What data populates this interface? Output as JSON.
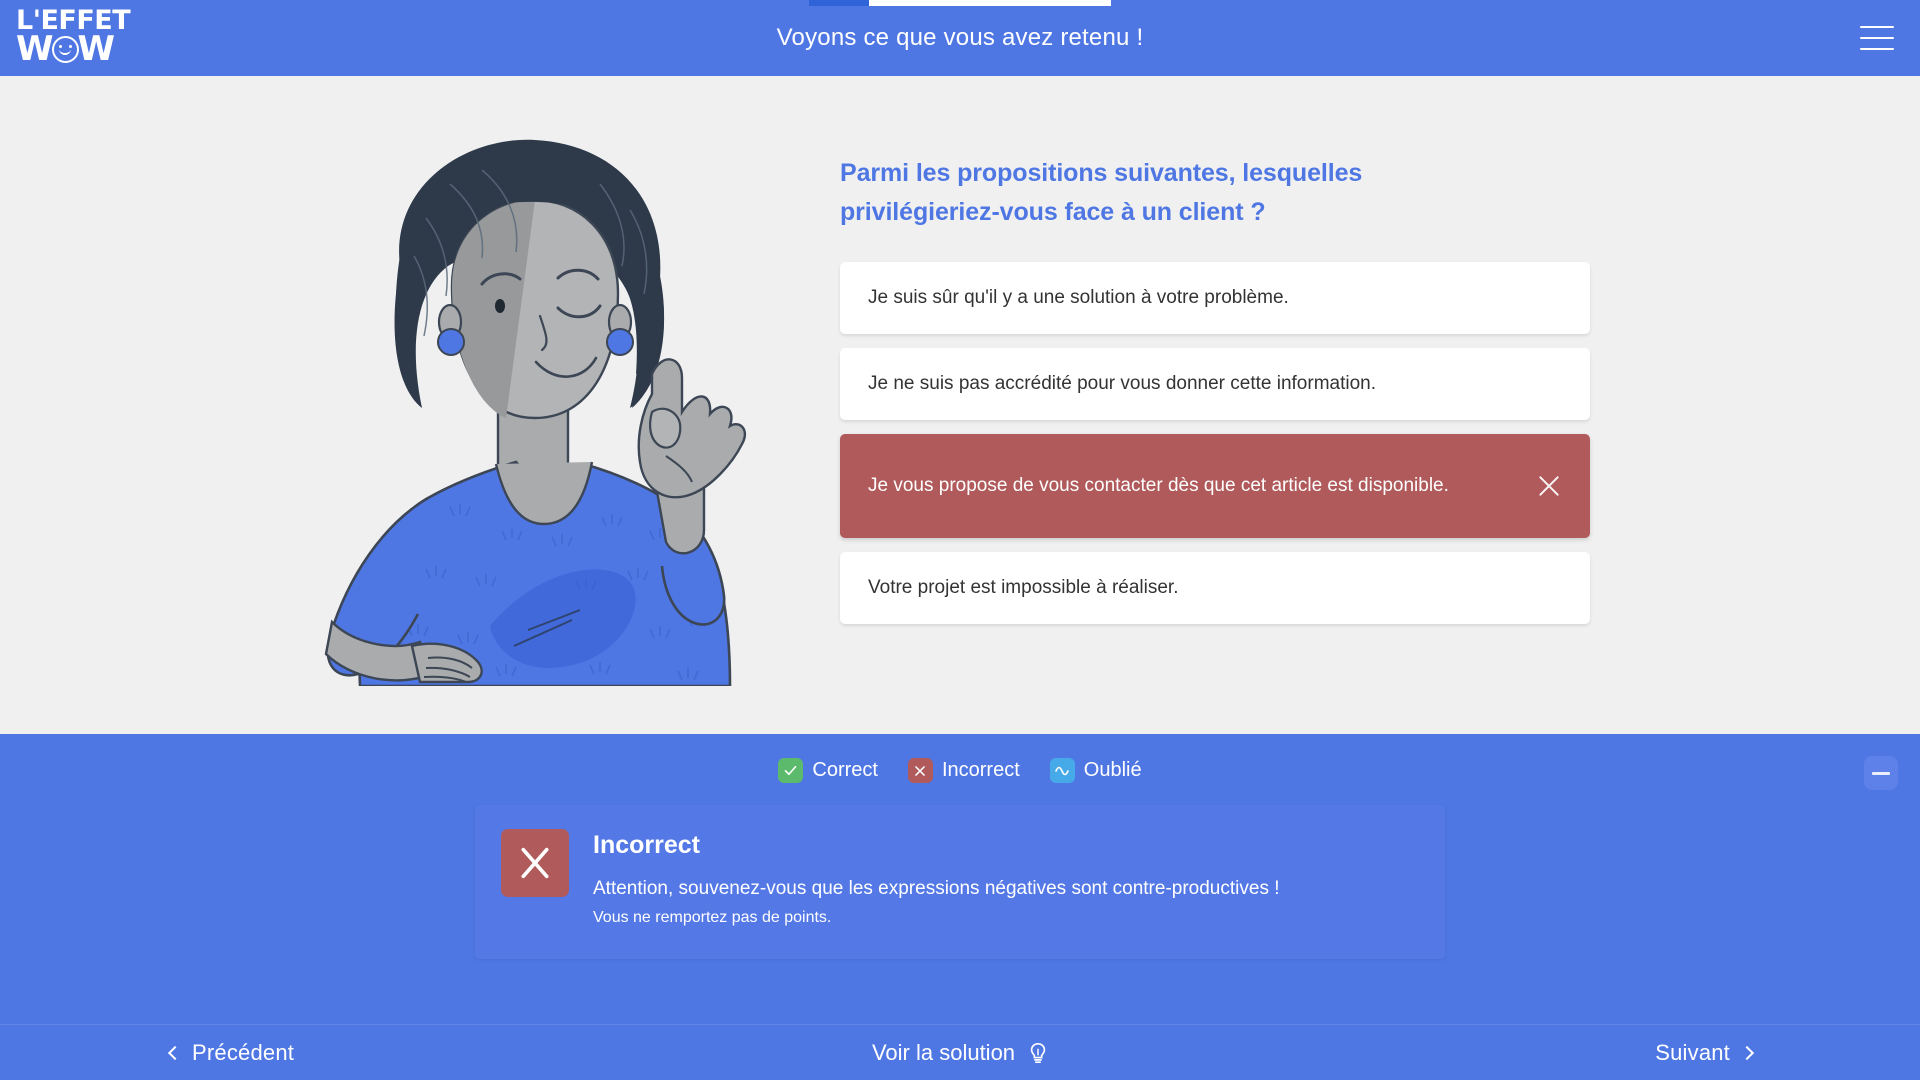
{
  "brand": {
    "logo_line1": "L'EFFET",
    "logo_line2_left": "W",
    "logo_line2_right": "W",
    "accent_blue": "#4f77e4",
    "incorrect_red": "#b05a5b",
    "correct_green": "#5cba6d",
    "forgot_blue": "#46aae8",
    "page_background": "#f0f0f1"
  },
  "header": {
    "title": "Voyons ce que vous avez retenu !",
    "menu_icon": "hamburger-icon",
    "progress_percent": 20
  },
  "illustration": {
    "name": "woman-ok-gesture-illustration",
    "description": "Femme souriante faisant un geste OK"
  },
  "quiz": {
    "question": "Parmi les propositions suivantes, lesquelles privilégieriez-vous face à un client ?",
    "options": [
      {
        "label": "Je suis sûr qu'il y a une solution à votre problème.",
        "state": "neutral",
        "mark": ""
      },
      {
        "label": "Je ne suis pas accrédité pour vous donner cette information.",
        "state": "neutral",
        "mark": ""
      },
      {
        "label": "Je vous propose de vous contacter dès que cet article est disponible.",
        "state": "incorrect",
        "mark": "close-icon"
      },
      {
        "label": "Votre projet est impossible à réaliser.",
        "state": "neutral",
        "mark": ""
      }
    ]
  },
  "legend": [
    {
      "label": "Correct",
      "icon": "check-icon",
      "color": "#5cba6d"
    },
    {
      "label": "Incorrect",
      "icon": "close-icon",
      "color": "#b05a5b"
    },
    {
      "label": "Oublié",
      "icon": "wave-icon",
      "color": "#46aae8"
    }
  ],
  "feedback": {
    "icon": "close-icon",
    "title": "Incorrect",
    "message": "Attention, souvenez-vous que les expressions négatives sont contre-productives !",
    "points": "Vous ne remportez pas de points.",
    "minimize_icon": "minimize-icon"
  },
  "footer": {
    "previous": "Précédent",
    "solution": "Voir la solution",
    "solution_icon": "lightbulb-icon",
    "next": "Suivant"
  }
}
